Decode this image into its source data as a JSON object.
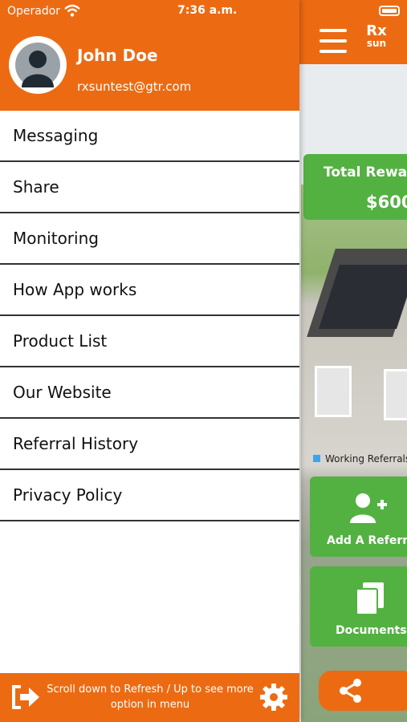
{
  "status_bar": {
    "carrier": "Operador",
    "time": "7:36 a.m."
  },
  "drawer": {
    "user": {
      "name": "John Doe",
      "email": "rxsuntest@gtr.com"
    },
    "menu_items": [
      {
        "label": "Messaging"
      },
      {
        "label": "Share"
      },
      {
        "label": "Monitoring"
      },
      {
        "label": "How App works"
      },
      {
        "label": "Product List"
      },
      {
        "label": "Our Website"
      },
      {
        "label": "Referral History"
      },
      {
        "label": "Privacy Policy"
      }
    ],
    "footer": {
      "text": "Scroll down to Refresh / Up to see more option in menu"
    }
  },
  "app": {
    "logo": {
      "top": "Rx",
      "bottom": "sun"
    },
    "rewards": {
      "title": "Total Rewar",
      "amount": "$600"
    },
    "legend": {
      "label": "Working Referrals"
    },
    "tiles": [
      {
        "label": "Add A Referral",
        "icon": "add-user-icon"
      },
      {
        "label": "Documents",
        "icon": "documents-icon"
      }
    ],
    "share_icon": "share-icon"
  },
  "colors": {
    "brand_orange": "#ec6b12",
    "green": "#53b141",
    "legend_blue": "#3da4f1"
  }
}
